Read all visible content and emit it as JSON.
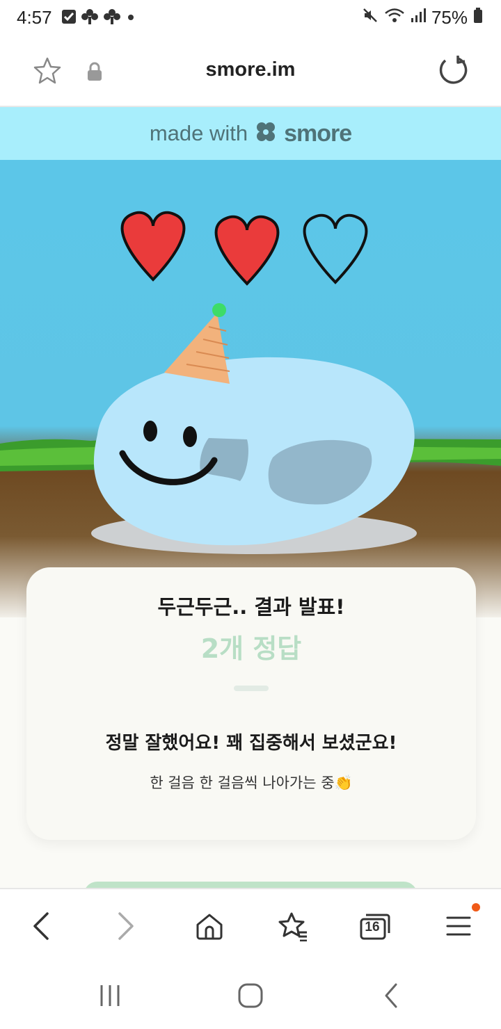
{
  "status_bar": {
    "time": "4:57",
    "battery": "75%",
    "left_icons": [
      "checkbox-icon",
      "clover-icon",
      "clover-icon",
      "dot-icon"
    ],
    "right_icons": [
      "mute-icon",
      "wifi-icon",
      "signal-icon",
      "battery-icon"
    ]
  },
  "address_bar": {
    "url": "smore.im",
    "left_icons": [
      "star-outline-icon",
      "lock-icon"
    ],
    "right_icon": "reload-icon"
  },
  "banner": {
    "text": "made with",
    "brand": "smore"
  },
  "scene": {
    "hearts_total": 3,
    "hearts_filled": 2,
    "heart_color": "#ea3b3b",
    "character": "blue slime with party hat"
  },
  "result_card": {
    "title": "두근두근.. 결과 발표!",
    "score": "2개 정답",
    "message": "정말 잘했어요! 꽤 집중해서 보셨군요!",
    "sub": "한 걸음 한 걸음씩 나아가는 중👏",
    "score_color": "#b8dec5"
  },
  "toolbar": {
    "tab_count": "16",
    "icons": [
      "back-icon",
      "forward-icon",
      "home-icon",
      "bookmarks-icon",
      "tabs-icon",
      "menu-icon"
    ],
    "notification_color": "#f05a18"
  },
  "navbar": {
    "icons": [
      "recents-icon",
      "home-circle-icon",
      "back-nav-icon"
    ]
  }
}
